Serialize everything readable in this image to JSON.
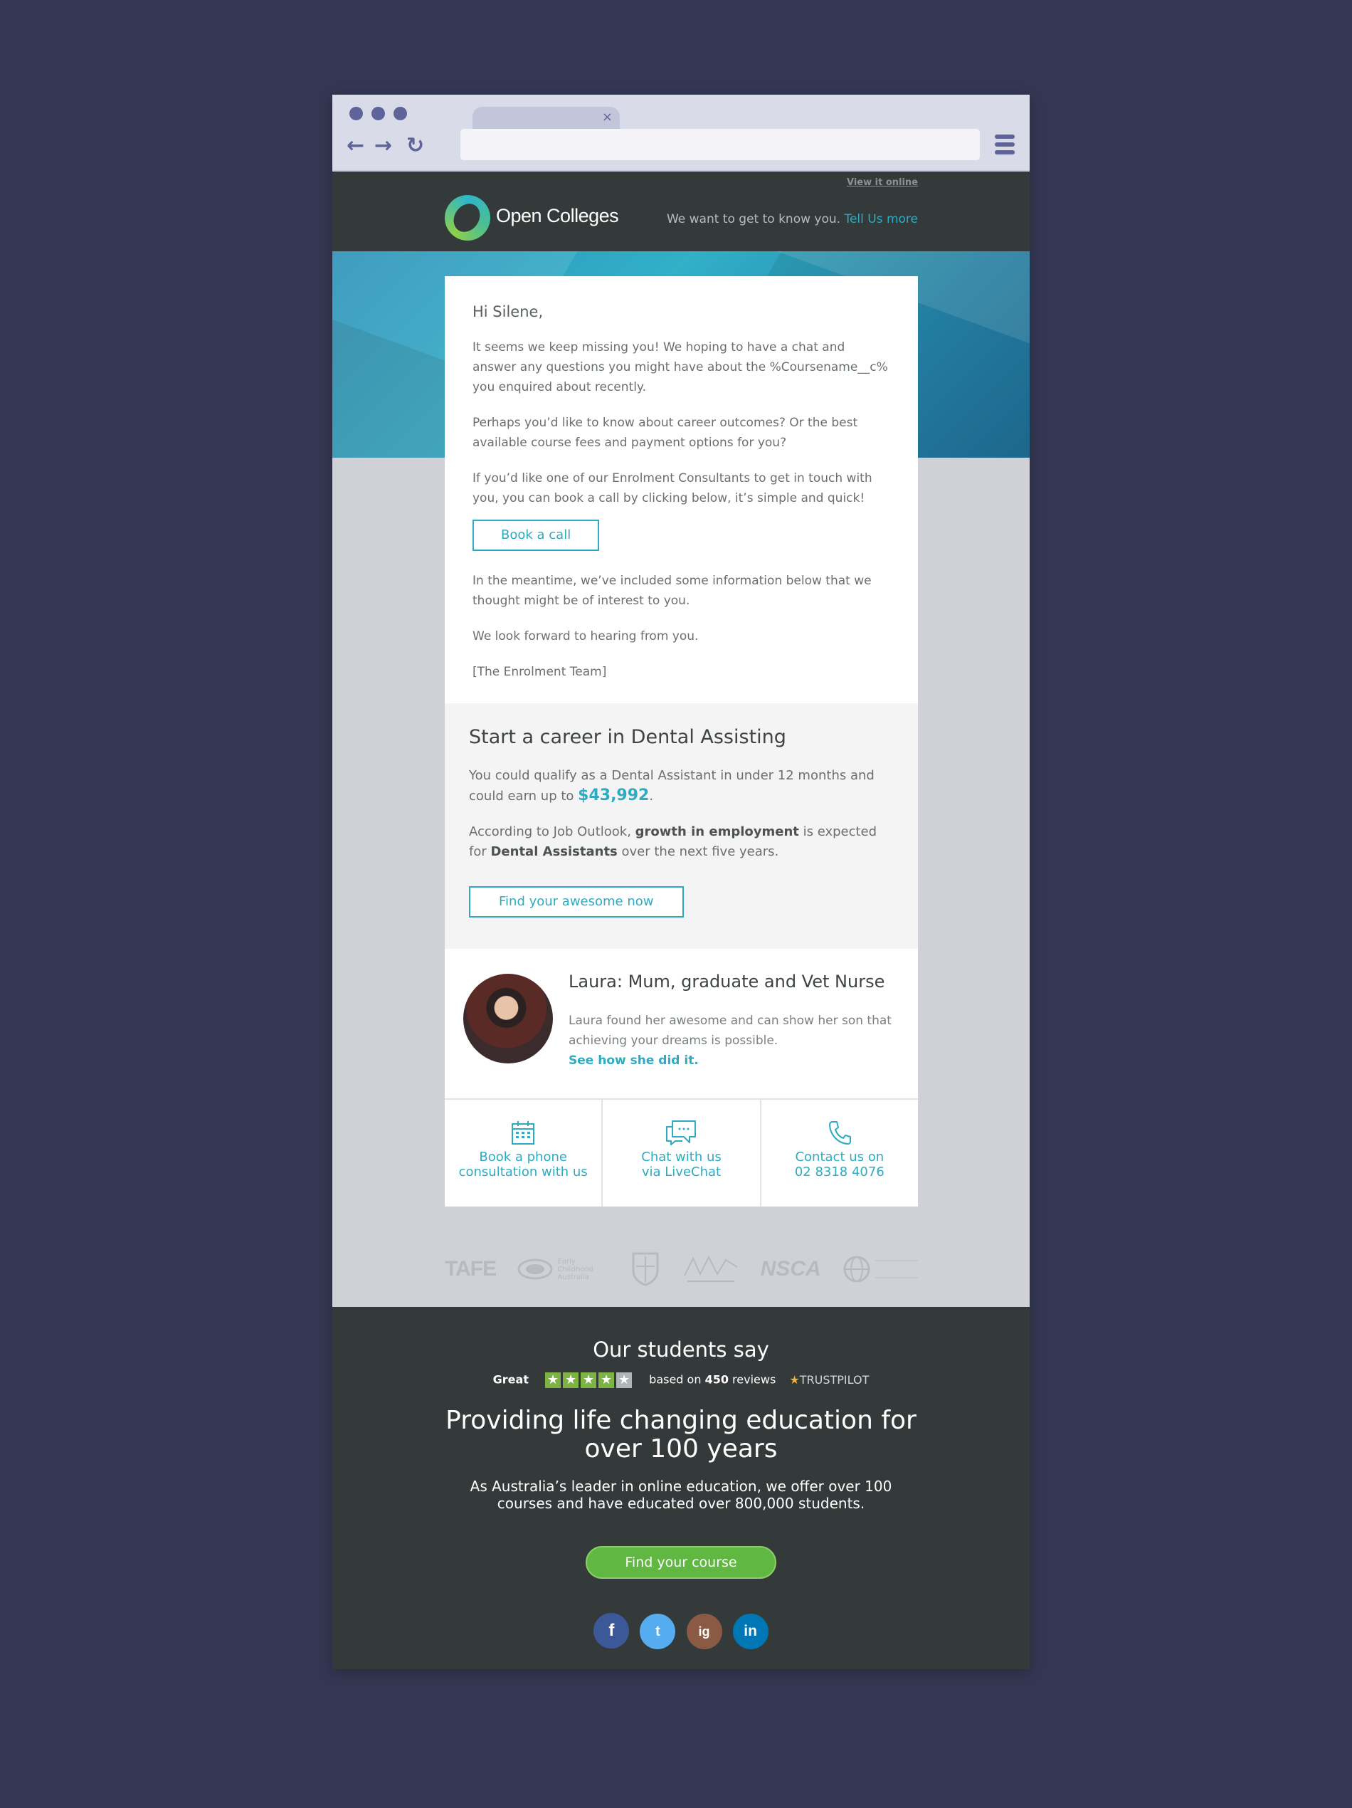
{
  "browser": {
    "tab_close": "×",
    "url_value": "",
    "back_icon": "←",
    "forward_icon": "→",
    "reload_icon": "↻"
  },
  "header": {
    "view_online": "View it online",
    "brand": "Open Colleges",
    "message": "We want to get to know you.",
    "message_link": "Tell Us more"
  },
  "letter": {
    "greeting": "Hi Silene,",
    "para1": "It seems we keep missing you! We hoping to have a chat and answer any questions you might have about the %Coursename__c% you enquired about recently.",
    "para2": "Perhaps you’d like to know about career outcomes? Or the best available course fees and payment options for you?",
    "para3": "If you’d like one of our Enrolment Consultants to get in touch with you, you can book a call by clicking below, it’s simple and quick!",
    "cta": "Book a call",
    "para4": "In the meantime, we’ve included some information below that we thought might be of interest to you.",
    "para5": "We look forward to hearing from you.",
    "signoff": "[The Enrolment Team]"
  },
  "career": {
    "title": "Start a career in Dental Assisting",
    "p1_a": "You could qualify as a Dental Assistant in under 12 months and could earn up to ",
    "p1_money": "$43,992",
    "p1_b": ".",
    "p2_a": "According to Job Outlook, ",
    "p2_bold1": "growth in employment",
    "p2_b": " is expected for ",
    "p2_bold2": "Dental Assistants",
    "p2_c": " over the next five years.",
    "cta": "Find your awesome now"
  },
  "testimonial": {
    "title": "Laura: Mum, graduate and Vet Nurse",
    "body": "Laura found her awesome and can show her son that achieving your dreams is possible.",
    "link": "See how she did it",
    "link_suffix": "."
  },
  "contacts": [
    {
      "line1": "Book a phone",
      "line2": "consultation with us",
      "icon": "calendar-icon"
    },
    {
      "line1": "Chat with us",
      "line2": "via LiveChat",
      "icon": "chat-icon"
    },
    {
      "line1": "Contact us on",
      "line2": "02 8318 4076",
      "icon": "phone-icon"
    }
  ],
  "accreditations": {
    "tafe": "TAFE",
    "ecia": "Early Childhood Australia",
    "crest": "",
    "aat": "",
    "nsca": "NSCA",
    "other": ""
  },
  "footer": {
    "students_say": "Our students say",
    "rating_word": "Great",
    "reviews_prefix": "based on ",
    "reviews_count": "450",
    "reviews_suffix": " reviews",
    "trustpilot": "TRUSTPILOT",
    "headline": "Providing life changing education for over 100 years",
    "description": "As Australia’s leader in online education, we offer over 100 courses and have educated over 800,000 students.",
    "cta": "Find your course",
    "social": [
      "f",
      "t",
      "ig",
      "in"
    ]
  },
  "colors": {
    "accent": "#2eaac2",
    "header_bg": "#343a3a",
    "cta_green": "#60b843",
    "page_bg": "#343752",
    "chrome_accent": "#5e6399"
  }
}
